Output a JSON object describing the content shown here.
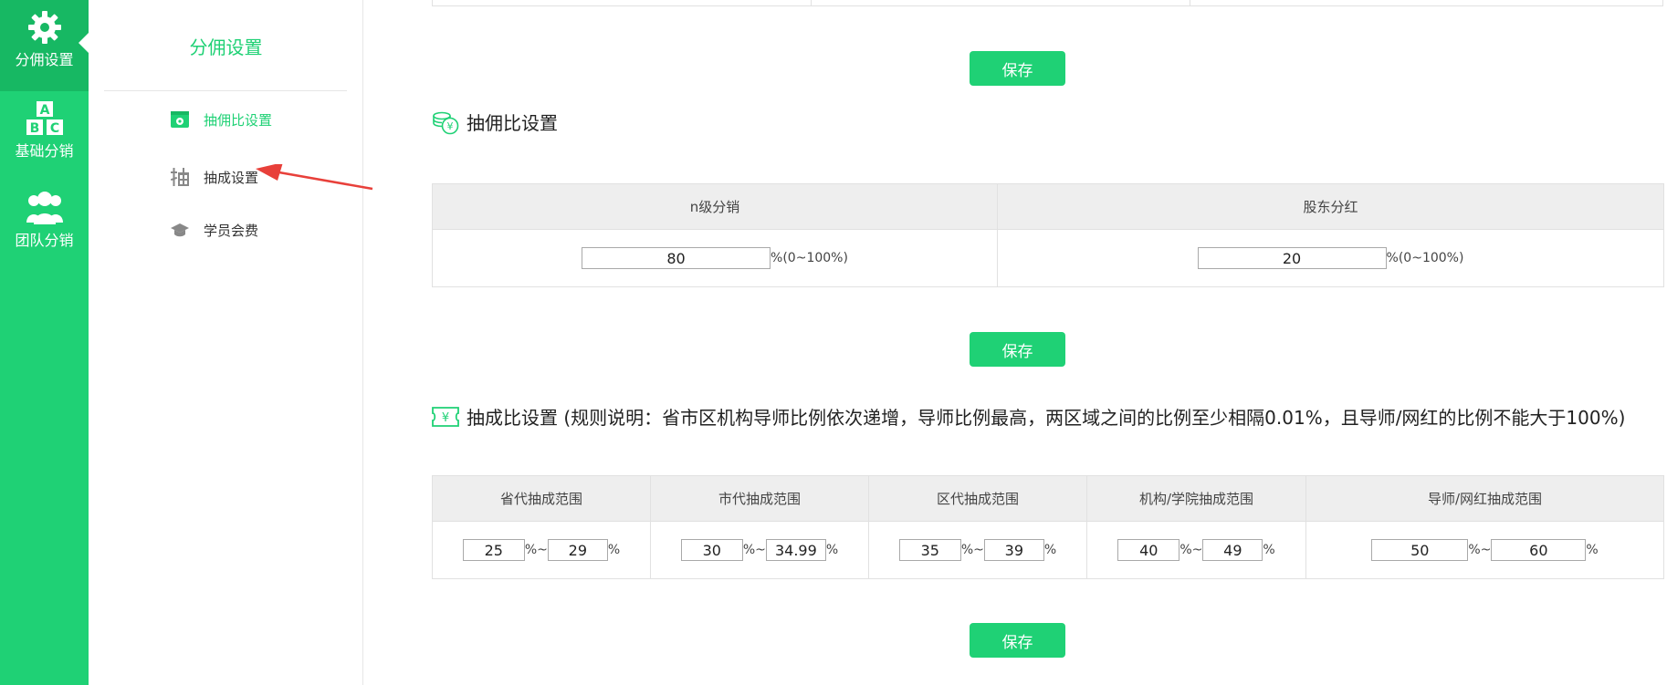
{
  "rail": {
    "items": [
      {
        "label": "分佣设置",
        "icon": "gear-icon"
      },
      {
        "label": "基础分销",
        "icon": "abc-blocks-icon"
      },
      {
        "label": "团队分销",
        "icon": "team-icon"
      }
    ]
  },
  "subnav": {
    "title": "分佣设置",
    "items": [
      {
        "label": "抽佣比设置",
        "icon": "settings-box-icon"
      },
      {
        "label": "抽成设置",
        "icon": "chou-character-icon"
      },
      {
        "label": "学员会费",
        "icon": "graduation-cap-icon"
      }
    ]
  },
  "colors": {
    "accent": "#1fd175",
    "accent_dark": "#17b863",
    "arrow": "#e8403a"
  },
  "main": {
    "save_label": "保存",
    "commission": {
      "title": "抽佣比设置",
      "columns": [
        "n级分销",
        "股东分红"
      ],
      "values": [
        "80",
        "20"
      ],
      "suffix": "%(0~100%)"
    },
    "split": {
      "title": "抽成比设置 (规则说明：省市区机构导师比例依次递增，导师比例最高，两区域之间的比例至少相隔0.01%，且导师/网红的比例不能大于100%)",
      "columns": [
        "省代抽成范围",
        "市代抽成范围",
        "区代抽成范围",
        "机构/学院抽成范围",
        "导师/网红抽成范围"
      ],
      "ranges": [
        {
          "min": "25",
          "max": "29"
        },
        {
          "min": "30",
          "max": "34.99"
        },
        {
          "min": "35",
          "max": "39"
        },
        {
          "min": "40",
          "max": "49"
        },
        {
          "min": "50",
          "max": "60"
        }
      ],
      "pct": "%",
      "sep": "%~"
    }
  }
}
